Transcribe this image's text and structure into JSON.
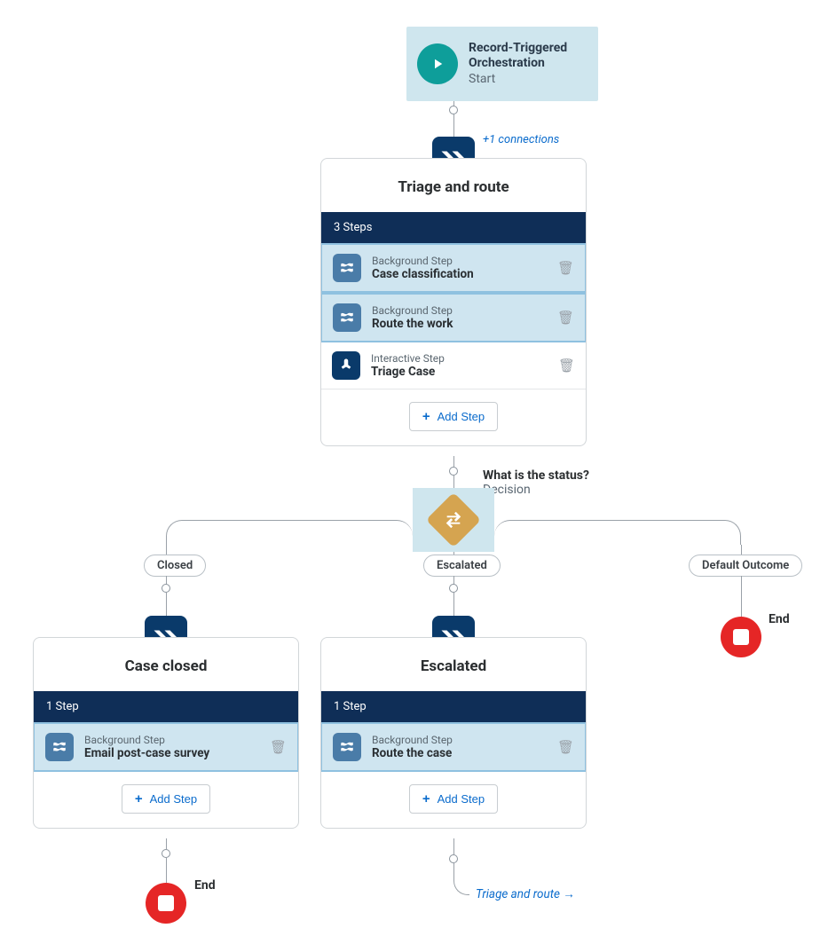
{
  "start": {
    "title": "Record-Triggered Orchestration",
    "subtitle": "Start"
  },
  "connections_note": "+1 connections",
  "stage1": {
    "title": "Triage and route",
    "header": "3 Steps",
    "steps": [
      {
        "category": "Background Step",
        "name": "Case classification",
        "kind": "background",
        "selected": true
      },
      {
        "category": "Background Step",
        "name": "Route the work",
        "kind": "background",
        "selected": true
      },
      {
        "category": "Interactive Step",
        "name": "Triage Case",
        "kind": "interactive",
        "selected": false
      }
    ],
    "add_label": "Add Step"
  },
  "decision": {
    "title": "What is the status?",
    "subtitle": "Decision",
    "outcomes": [
      "Closed",
      "Escalated",
      "Default Outcome"
    ]
  },
  "stage2": {
    "title": "Case closed",
    "header": "1 Step",
    "steps": [
      {
        "category": "Background Step",
        "name": "Email post-case survey",
        "kind": "background",
        "selected": true
      }
    ],
    "add_label": "Add Step"
  },
  "stage3": {
    "title": "Escalated",
    "header": "1 Step",
    "steps": [
      {
        "category": "Background Step",
        "name": "Route the case",
        "kind": "background",
        "selected": true
      }
    ],
    "add_label": "Add Step"
  },
  "end_label": "End",
  "loop_label": "Triage and route →"
}
